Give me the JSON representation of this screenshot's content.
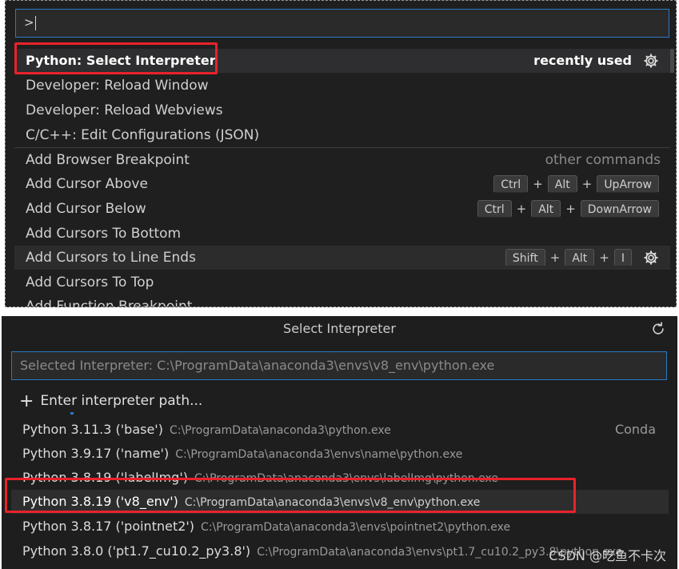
{
  "command_palette": {
    "input_value": ">",
    "first_item": {
      "label": "Python: Select Interpreter",
      "hint": "recently used"
    },
    "recent": [
      "Developer: Reload Window",
      "Developer: Reload Webviews",
      "C/C++: Edit Configurations (JSON)"
    ],
    "other_commands_label": "other commands",
    "commands": [
      {
        "label": "Add Browser Breakpoint",
        "keys": []
      },
      {
        "label": "Add Cursor Above",
        "keys": [
          "Ctrl",
          "Alt",
          "UpArrow"
        ]
      },
      {
        "label": "Add Cursor Below",
        "keys": [
          "Ctrl",
          "Alt",
          "DownArrow"
        ]
      },
      {
        "label": "Add Cursors To Bottom",
        "keys": []
      },
      {
        "label": "Add Cursors to Line Ends",
        "keys": [
          "Shift",
          "Alt",
          "I"
        ]
      },
      {
        "label": "Add Cursors To Top",
        "keys": []
      },
      {
        "label": "Add Function Breakpoint",
        "keys": []
      }
    ],
    "plus": "+"
  },
  "interpreter": {
    "title": "Select Interpreter",
    "placeholder": "Selected Interpreter: C:\\ProgramData\\anaconda3\\envs\\v8_env\\python.exe",
    "enter_path": "Enter interpreter path...",
    "items": [
      {
        "name": "Python 3.11.3 ('base')",
        "path": "C:\\ProgramData\\anaconda3\\python.exe",
        "tag": "Conda"
      },
      {
        "name": "Python 3.9.17 ('name')",
        "path": "C:\\ProgramData\\anaconda3\\envs\\name\\python.exe",
        "tag": ""
      },
      {
        "name": "Python 3.8.19 ('labelImg')",
        "path": "C:\\ProgramData\\anaconda3\\envs\\labelImg\\python.exe",
        "tag": ""
      },
      {
        "name": "Python 3.8.19 ('v8_env')",
        "path": "C:\\ProgramData\\anaconda3\\envs\\v8_env\\python.exe",
        "tag": ""
      },
      {
        "name": "Python 3.8.17 ('pointnet2')",
        "path": "C:\\ProgramData\\anaconda3\\envs\\pointnet2\\python.exe",
        "tag": ""
      },
      {
        "name": "Python 3.8.0 ('pt1.7_cu10.2_py3.8')",
        "path": "C:\\ProgramData\\anaconda3\\envs\\pt1.7_cu10.2_py3.8\\python.exe",
        "tag": ""
      }
    ]
  },
  "watermark": "CSDN @吃鱼不卡次",
  "colors": {
    "highlight": "#e8232a",
    "focus": "#2b79c2",
    "background": "#1f1f1f"
  }
}
